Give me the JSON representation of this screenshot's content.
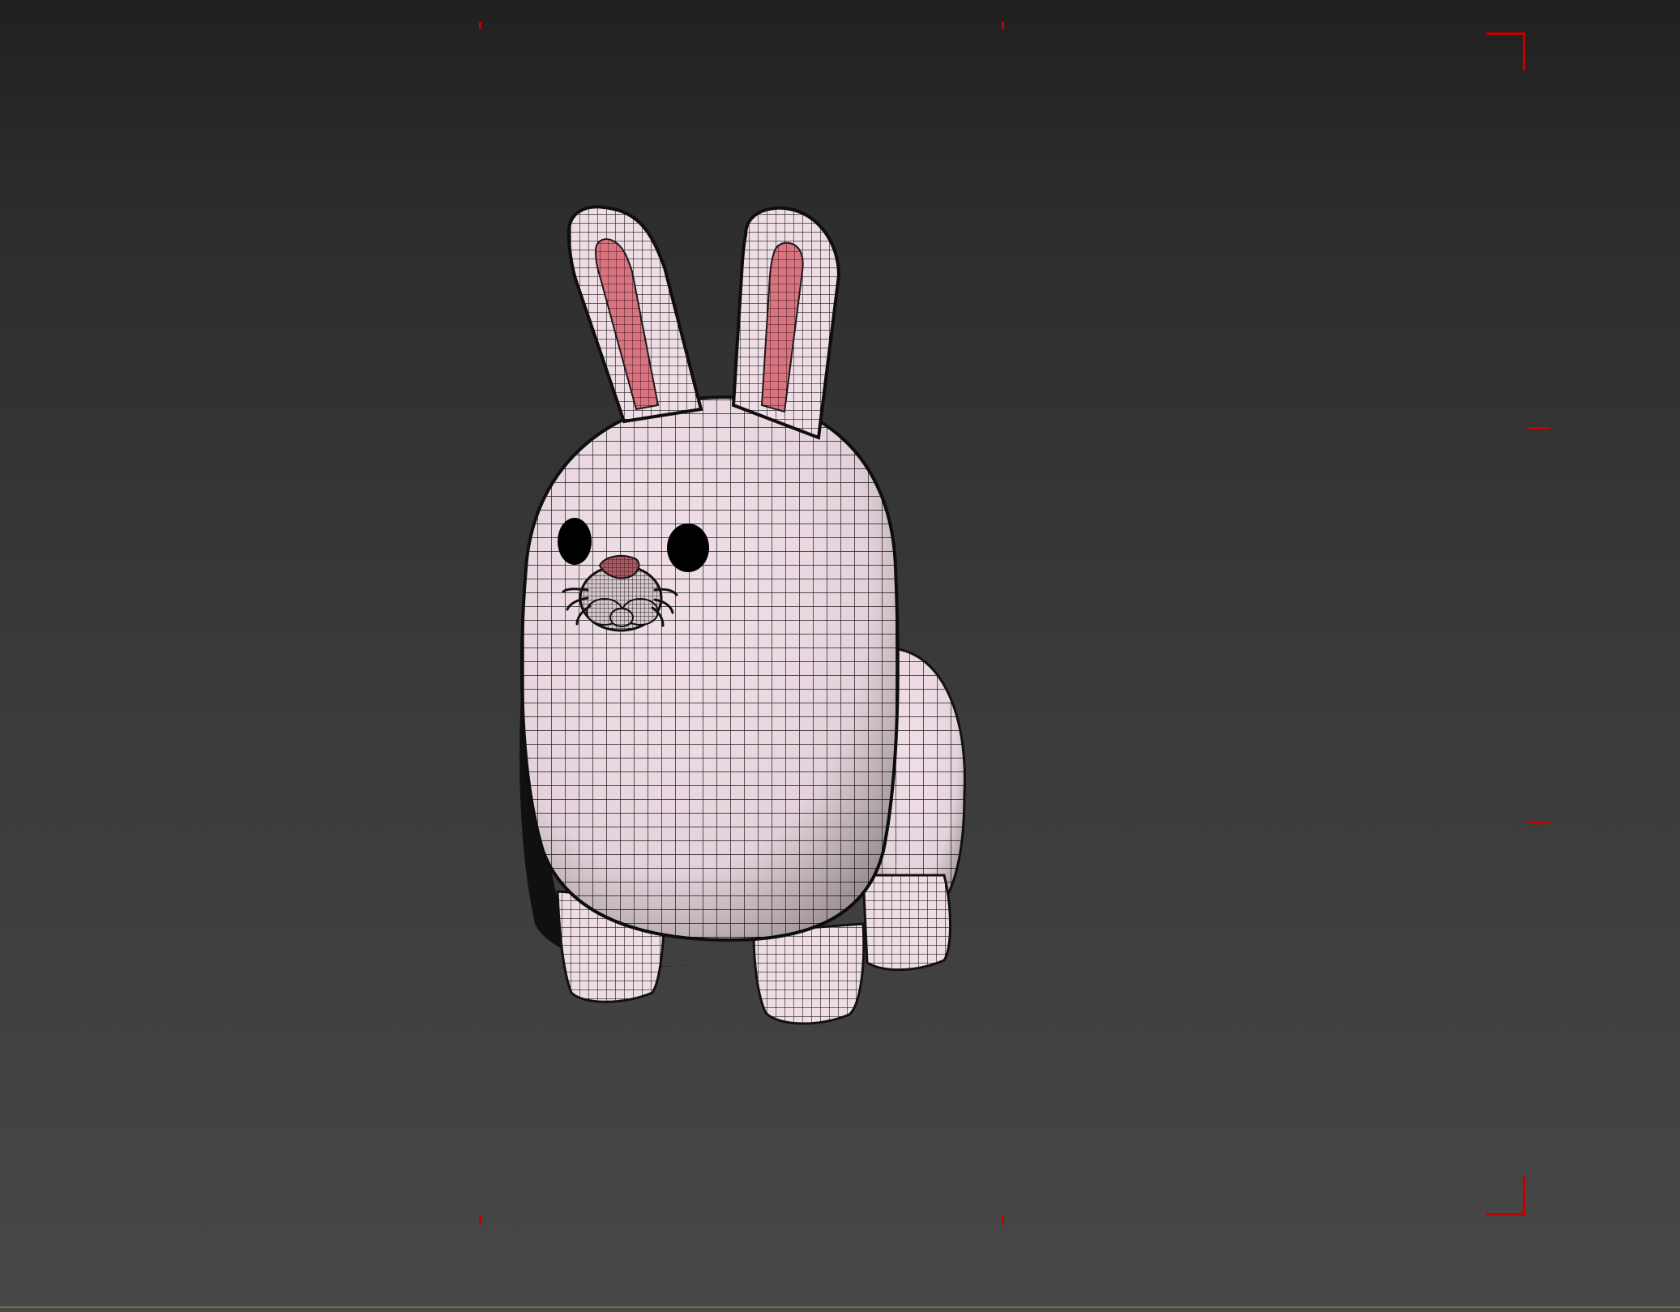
{
  "viewport": {
    "shading_mode": "edged-faces",
    "background": "gradient",
    "safe_frame_color": "#c40000",
    "model": {
      "name": "bunny",
      "body_color": "#efdde6",
      "inner_ear_color": "#d9737f",
      "nose_color": "#a85a63",
      "eye_color": "#000000",
      "wire_color": "#1a1a1a"
    }
  }
}
